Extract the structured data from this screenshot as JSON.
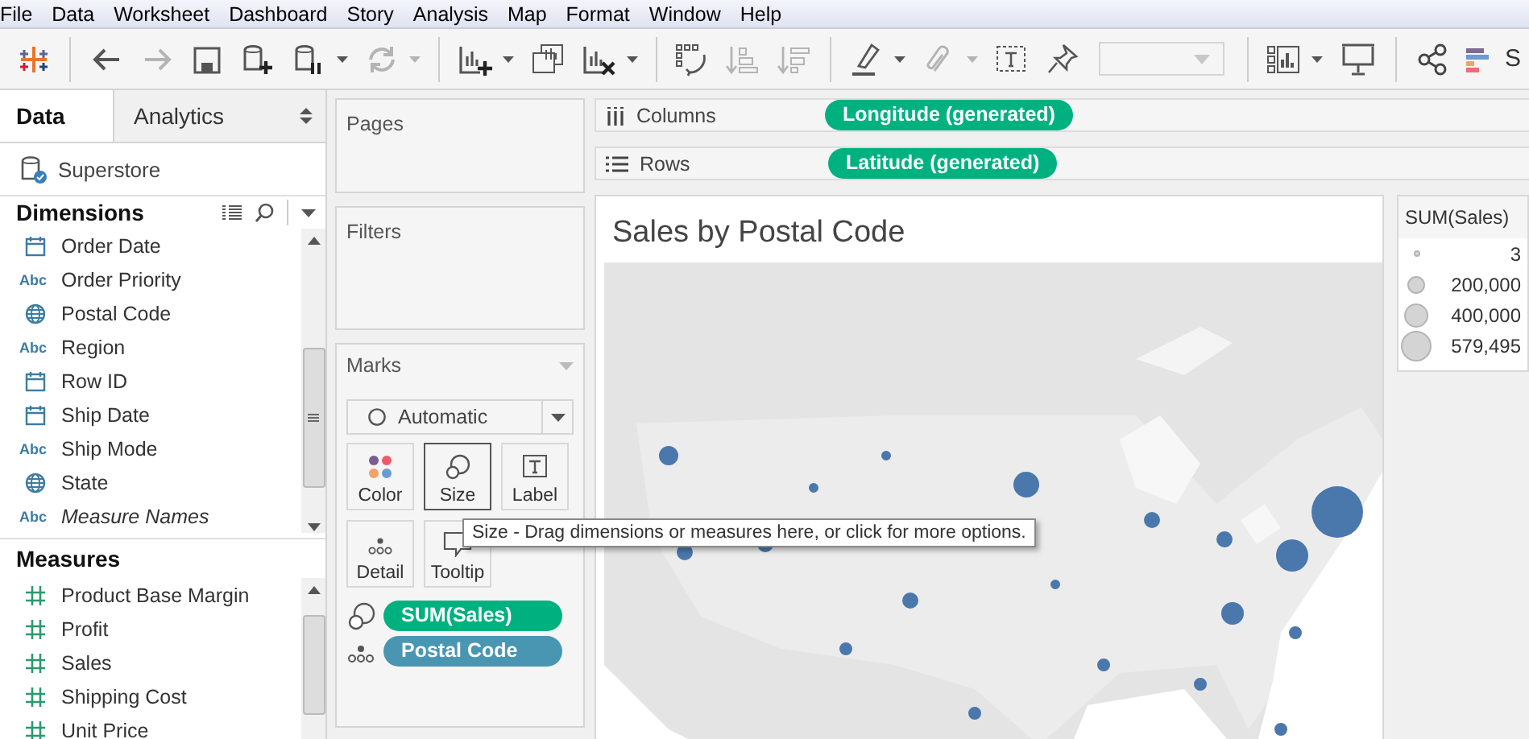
{
  "menu": [
    "File",
    "Data",
    "Worksheet",
    "Dashboard",
    "Story",
    "Analysis",
    "Map",
    "Format",
    "Window",
    "Help"
  ],
  "toolbar": [
    {
      "kind": "logo",
      "disabled": false,
      "has_menu": false
    },
    {
      "kind": "sep"
    },
    {
      "kind": "back",
      "disabled": false,
      "has_menu": false
    },
    {
      "kind": "forward",
      "disabled": true,
      "has_menu": false
    },
    {
      "kind": "save",
      "disabled": false,
      "has_menu": false
    },
    {
      "kind": "new-datasource",
      "disabled": false,
      "has_menu": false
    },
    {
      "kind": "pause",
      "disabled": false,
      "has_menu": true
    },
    {
      "kind": "refresh",
      "disabled": true,
      "has_menu": true
    },
    {
      "kind": "sep"
    },
    {
      "kind": "new-sheet",
      "disabled": false,
      "has_menu": true
    },
    {
      "kind": "duplicate",
      "disabled": false,
      "has_menu": false
    },
    {
      "kind": "clear",
      "disabled": false,
      "has_menu": true
    },
    {
      "kind": "sep"
    },
    {
      "kind": "swap",
      "disabled": false,
      "has_menu": false
    },
    {
      "kind": "sort-asc",
      "disabled": true,
      "has_menu": false
    },
    {
      "kind": "sort-desc",
      "disabled": true,
      "has_menu": false
    },
    {
      "kind": "sep"
    },
    {
      "kind": "highlight",
      "disabled": false,
      "has_menu": true
    },
    {
      "kind": "attach",
      "disabled": true,
      "has_menu": true
    },
    {
      "kind": "textbox",
      "disabled": false,
      "has_menu": false
    },
    {
      "kind": "pin",
      "disabled": false,
      "has_menu": false
    },
    {
      "kind": "combo",
      "disabled": true
    },
    {
      "kind": "sep"
    },
    {
      "kind": "show-me",
      "disabled": false,
      "has_menu": true
    },
    {
      "kind": "present",
      "disabled": false,
      "has_menu": false
    },
    {
      "kind": "sep"
    },
    {
      "kind": "share",
      "disabled": false,
      "has_menu": false
    },
    {
      "kind": "story-bars",
      "disabled": false,
      "has_menu": false,
      "label": "S"
    }
  ],
  "side_tabs": [
    {
      "label": "Data",
      "selected": true
    },
    {
      "label": "Analytics",
      "selected": false
    }
  ],
  "datasource": "Superstore",
  "dimensions": {
    "title": "Dimensions",
    "items": [
      {
        "kind": "date",
        "label": "Order Date",
        "italic": false
      },
      {
        "kind": "string",
        "badge": "Abc",
        "label": "Order Priority",
        "italic": false
      },
      {
        "kind": "geo",
        "label": "Postal Code",
        "italic": false
      },
      {
        "kind": "string",
        "badge": "Abc",
        "label": "Region",
        "italic": false
      },
      {
        "kind": "date",
        "label": "Row ID",
        "italic": false
      },
      {
        "kind": "date",
        "label": "Ship Date",
        "italic": false
      },
      {
        "kind": "string",
        "badge": "Abc",
        "label": "Ship Mode",
        "italic": false
      },
      {
        "kind": "geo",
        "label": "State",
        "italic": false
      },
      {
        "kind": "string",
        "badge": "Abc",
        "label": "Measure Names",
        "italic": true
      }
    ]
  },
  "measures": {
    "title": "Measures",
    "items": [
      {
        "kind": "number",
        "label": "Product Base Margin",
        "italic": false
      },
      {
        "kind": "number",
        "label": "Profit",
        "italic": false
      },
      {
        "kind": "number",
        "label": "Sales",
        "italic": false
      },
      {
        "kind": "number",
        "label": "Shipping Cost",
        "italic": false
      },
      {
        "kind": "number",
        "label": "Unit Price",
        "italic": false
      }
    ]
  },
  "pages": {
    "title": "Pages"
  },
  "filters": {
    "title": "Filters"
  },
  "marks": {
    "title": "Marks",
    "mark_type": "Automatic",
    "cards": [
      {
        "kind": "color",
        "label": "Color",
        "selected": false
      },
      {
        "kind": "size",
        "label": "Size",
        "selected": true
      },
      {
        "kind": "label",
        "label": "Label",
        "selected": false
      },
      {
        "kind": "detail",
        "label": "Detail",
        "selected": false
      },
      {
        "kind": "tooltip",
        "label": "Tooltip",
        "selected": false
      }
    ],
    "pills": [
      {
        "kind": "size",
        "label": "SUM(Sales)",
        "color": "#00b180"
      },
      {
        "kind": "detail",
        "label": "Postal Code",
        "color": "#4996b2"
      }
    ]
  },
  "columns": {
    "label": "Columns",
    "pills": [
      {
        "label": "Longitude (generated)",
        "color": "#00b180"
      }
    ]
  },
  "rows": {
    "label": "Rows",
    "pills": [
      {
        "label": "Latitude (generated)",
        "color": "#00b180"
      }
    ]
  },
  "view": {
    "title": "Sales by Postal Code"
  },
  "legend": {
    "title": "SUM(Sales)",
    "items": [
      "3",
      "200,000",
      "400,000",
      "579,495"
    ]
  },
  "tooltip": "Size - Drag dimensions or measures here, or click for more options."
}
